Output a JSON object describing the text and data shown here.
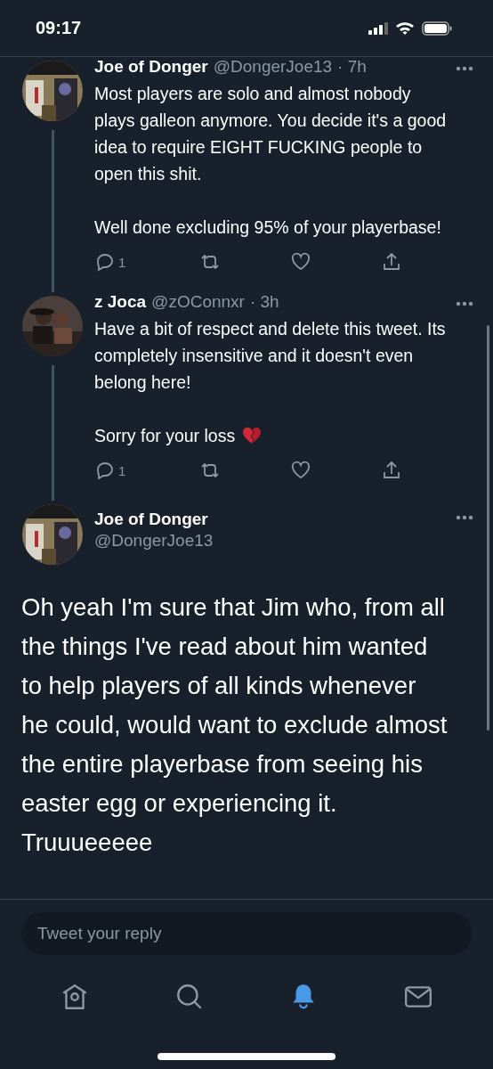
{
  "status_bar": {
    "time": "09:17"
  },
  "replies": [
    {
      "name": "Joe of Donger",
      "handle": "@DongerJoe13",
      "time": "· 7h",
      "paragraphs": [
        "Most players are solo and almost nobody plays galleon anymore. You decide it's a good idea to require EIGHT FUCKING people to open this shit.",
        "Well done excluding 95% of your playerbase!"
      ],
      "reply_count": "1"
    },
    {
      "name": "z Joca",
      "handle": "@zOConnxr",
      "time": "· 3h",
      "paragraphs": [
        "Have a bit of respect and delete this tweet. Its completely insensitive and it doesn't even belong here!",
        "Sorry for your loss"
      ],
      "emoji": {
        "kind": "broken_heart"
      },
      "reply_count": "1"
    }
  ],
  "main_tweet": {
    "name": "Joe of Donger",
    "handle": "@DongerJoe13",
    "text": "Oh yeah I'm sure that Jim who, from all the things I've read about him wanted to help players of all kinds whenever he could, would want to exclude almost the entire playerbase from seeing his easter egg or experiencing it. Truuueeeee"
  },
  "reply_field": {
    "placeholder": "Tweet your reply"
  },
  "tabs": [
    {
      "kind": "home",
      "selected": false
    },
    {
      "kind": "search",
      "selected": false
    },
    {
      "kind": "notifications",
      "selected": true
    },
    {
      "kind": "messages",
      "selected": false
    }
  ]
}
